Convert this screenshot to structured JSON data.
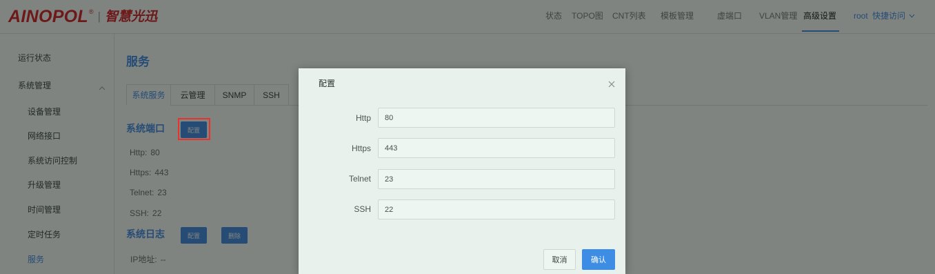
{
  "colors": {
    "accent": "#4a8fe6",
    "brand": "#d9262d",
    "confirm": "#3d8de4",
    "highlight": "#e8322c"
  },
  "header": {
    "logo": {
      "brand": "AINOPOL",
      "registered": "®",
      "separator": "|",
      "slogan": "智慧光迅"
    },
    "nav": [
      {
        "label": "状态"
      },
      {
        "label": "TOPO图"
      },
      {
        "label": "CNT列表"
      },
      {
        "label": "模板管理"
      },
      {
        "label": "虚端口"
      },
      {
        "label": "VLAN管理"
      },
      {
        "label": "高级设置",
        "active": true
      }
    ],
    "user": "root",
    "quick_access": {
      "label": "快捷访问",
      "icon": "chevron-down-icon"
    }
  },
  "sidebar": {
    "items": [
      {
        "label": "运行状态"
      },
      {
        "label": "系统管理",
        "expanded": true,
        "icon": "chevron-up-icon",
        "children": [
          {
            "label": "设备管理"
          },
          {
            "label": "网络接口"
          },
          {
            "label": "系统访问控制"
          },
          {
            "label": "升级管理"
          },
          {
            "label": "时间管理"
          },
          {
            "label": "定时任务"
          },
          {
            "label": "服务",
            "active": true
          }
        ]
      }
    ]
  },
  "main": {
    "title": "服务",
    "tabs": [
      {
        "label": "系统服务",
        "active": true
      },
      {
        "label": "云管理"
      },
      {
        "label": "SNMP"
      },
      {
        "label": "SSH"
      }
    ],
    "ports": {
      "title": "系统端口",
      "config_button": "配置",
      "rows": [
        {
          "label": "Http:",
          "value": "80"
        },
        {
          "label": "Https:",
          "value": "443"
        },
        {
          "label": "Telnet:",
          "value": "23"
        },
        {
          "label": "SSH:",
          "value": "22"
        }
      ]
    },
    "log": {
      "title": "系统日志",
      "config_button": "配置",
      "delete_button": "删除",
      "ip_label": "IP地址:",
      "ip_value": "--"
    }
  },
  "modal": {
    "title": "配置",
    "close_icon": "close-icon",
    "fields": [
      {
        "label": "Http",
        "value": "80"
      },
      {
        "label": "Https",
        "value": "443"
      },
      {
        "label": "Telnet",
        "value": "23"
      },
      {
        "label": "SSH",
        "value": "22"
      }
    ],
    "cancel": "取消",
    "confirm": "确认"
  }
}
